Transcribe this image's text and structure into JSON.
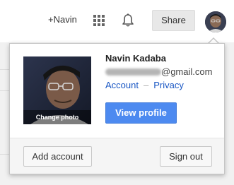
{
  "header": {
    "plus_link": "+Navin",
    "share_label": "Share",
    "icons": [
      "apps-grid-icon",
      "notifications-bell-icon"
    ]
  },
  "account": {
    "name": "Navin Kadaba",
    "email_domain": "@gmail.com",
    "account_link": "Account",
    "link_separator": "–",
    "privacy_link": "Privacy",
    "change_photo": "Change photo",
    "view_profile": "View profile"
  },
  "footer": {
    "add_account": "Add account",
    "sign_out": "Sign out"
  },
  "colors": {
    "primary_button": "#4d8af0",
    "link": "#1a57c4",
    "background": "#f1f1f1"
  }
}
